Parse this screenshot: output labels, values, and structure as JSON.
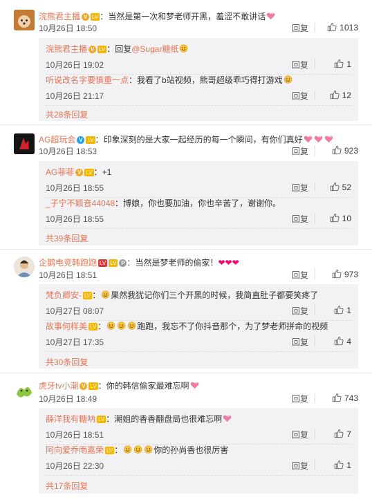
{
  "threads": [
    {
      "user": "浣熊君主播",
      "text": "当然是第一次和梦老师开黑，羞涩不敢讲话",
      "time": "10月26日 18:50",
      "likes": "1013",
      "replies": [
        {
          "user": "浣熊君主播",
          "prefix": "回复",
          "mention": "@Sugar糖纸",
          "text": "",
          "time": "10月26日 19:02",
          "likes": "1"
        },
        {
          "user": "听说改名字要慎重一点",
          "prefix": "",
          "mention": "",
          "text": "我看了b站视频，熊哥超级乖巧得打游戏",
          "time": "10月26日 21:17",
          "likes": "12"
        }
      ],
      "more": "共28条回复"
    },
    {
      "user": "AG超玩会",
      "text": "印象深刻的是大家一起经历的每一个瞬间，有你们真好",
      "time": "10月26日 18:53",
      "likes": "923",
      "replies": [
        {
          "user": "AG菲菲",
          "prefix": "",
          "mention": "",
          "text": "+1",
          "time": "10月26日 18:55",
          "likes": "52"
        },
        {
          "user": "_子宁不颖音44048",
          "prefix": "",
          "mention": "",
          "text": "博娘，你也要加油，你也辛苦了，谢谢你。",
          "time": "10月26日 18:55",
          "likes": "10"
        }
      ],
      "more": "共39条回复"
    },
    {
      "user": "企鹅电竞韩跑跑",
      "text": "当然是梦老师的偷家！",
      "time": "10月26日 18:51",
      "likes": "973",
      "replies": [
        {
          "user": "梵负卿安-",
          "prefix": "",
          "mention": "",
          "text": "果然我犹记你们三个开黑的时候，我简直肚子都要笑疼了",
          "time": "10月27日 08:07",
          "likes": "1"
        },
        {
          "user": "故事何样美",
          "prefix": "",
          "mention": "",
          "text": "跑跑，我忘不了你抖音那个，为了梦老师拼命的视频",
          "time": "10月27日 17:35",
          "likes": "4"
        }
      ],
      "more": "共30条回复"
    },
    {
      "user": "虎牙tv小潮",
      "text": "你的韩信偷家最难忘啊",
      "time": "10月26日 18:49",
      "likes": "743",
      "replies": [
        {
          "user": "薛洋我有糖呐",
          "prefix": "",
          "mention": "",
          "text": "潮姐的香香翻盘局也很难忘啊",
          "time": "10月26日 18:51",
          "likes": "7"
        },
        {
          "user": "阿向爱乔雨嘉荣",
          "prefix": "",
          "mention": "",
          "text": "你的孙尚香也很厉害",
          "time": "10月26日 22:30",
          "likes": "1"
        }
      ],
      "more": "共17条回复"
    }
  ],
  "labels": {
    "reply": "回复",
    "heart": "❤❤❤",
    "lv": "LV"
  },
  "colors": {
    "username": "#eb7350",
    "reply_bg": "#f2f2f5"
  },
  "icons": [
    "thumb-up-icon",
    "verified-icon",
    "level-badge-icon",
    "emoji-icon"
  ]
}
